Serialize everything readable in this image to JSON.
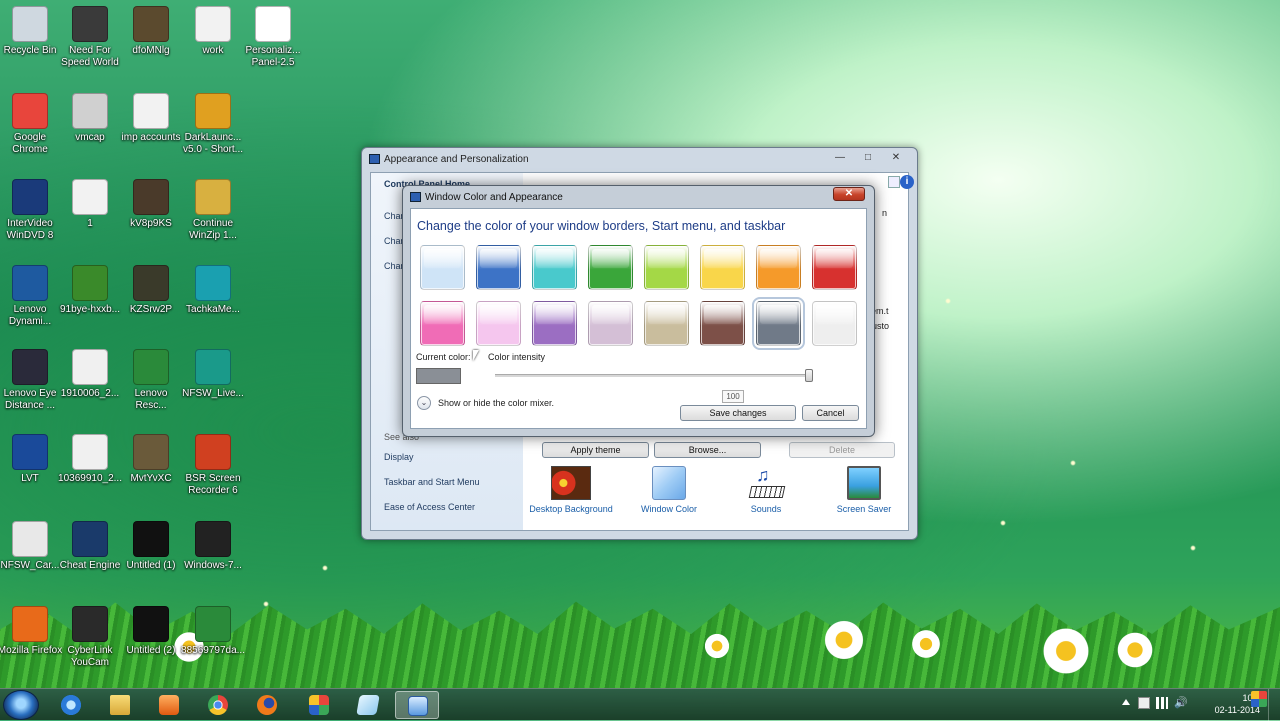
{
  "desktop": {
    "icons": [
      {
        "label": "Recycle Bin",
        "col": 0,
        "row": 0,
        "color": "#cfd8e0"
      },
      {
        "label": "Need For Speed World",
        "col": 1,
        "row": 0,
        "color": "#3a3a3a"
      },
      {
        "label": "dfoMNlg",
        "col": 2,
        "row": 0,
        "color": "#5b4a2e"
      },
      {
        "label": "work",
        "col": 3,
        "row": 0,
        "color": "#f2f2f2"
      },
      {
        "label": "Personaliz... Panel-2.5",
        "col": 4,
        "row": 0,
        "color": "#ffffff"
      },
      {
        "label": "Google Chrome",
        "col": 0,
        "row": 1,
        "color": "#e8453c"
      },
      {
        "label": "vmcap",
        "col": 1,
        "row": 1,
        "color": "#d0d0d0"
      },
      {
        "label": "imp accounts",
        "col": 2,
        "row": 1,
        "color": "#f2f2f2"
      },
      {
        "label": "DarkLaunc... v5.0 - Short...",
        "col": 3,
        "row": 1,
        "color": "#e0a020"
      },
      {
        "label": "InterVideo WinDVD 8",
        "col": 0,
        "row": 2,
        "color": "#1a3a7a"
      },
      {
        "label": "1",
        "col": 1,
        "row": 2,
        "color": "#f2f2f2"
      },
      {
        "label": "kV8p9KS",
        "col": 2,
        "row": 2,
        "color": "#4a3a2a"
      },
      {
        "label": "Continue WinZip 1...",
        "col": 3,
        "row": 2,
        "color": "#d8b040"
      },
      {
        "label": "Lenovo Dynami...",
        "col": 0,
        "row": 3,
        "color": "#1e5aa0"
      },
      {
        "label": "91bye-hxxb...",
        "col": 1,
        "row": 3,
        "color": "#3a8a2a"
      },
      {
        "label": "KZSrw2P",
        "col": 2,
        "row": 3,
        "color": "#3a3a2a"
      },
      {
        "label": "TachkaMe...",
        "col": 3,
        "row": 3,
        "color": "#1aa0b0"
      },
      {
        "label": "Lenovo Eye Distance ...",
        "col": 0,
        "row": 4,
        "color": "#2a2a3a"
      },
      {
        "label": "1910006_2...",
        "col": 1,
        "row": 4,
        "color": "#f0f0f0"
      },
      {
        "label": "Lenovo Resc...",
        "col": 2,
        "row": 4,
        "color": "#2a8a3a"
      },
      {
        "label": "NFSW_Live...",
        "col": 3,
        "row": 4,
        "color": "#1a9a8a"
      },
      {
        "label": "LVT",
        "col": 0,
        "row": 5,
        "color": "#1a4a9a"
      },
      {
        "label": "10369910_2...",
        "col": 1,
        "row": 5,
        "color": "#f0f0f0"
      },
      {
        "label": "MvtYvXC",
        "col": 2,
        "row": 5,
        "color": "#6a5a3a"
      },
      {
        "label": "BSR Screen Recorder 6",
        "col": 3,
        "row": 5,
        "color": "#d04020"
      },
      {
        "label": "NFSW_Car...",
        "col": 0,
        "row": 6,
        "color": "#e8e8e8"
      },
      {
        "label": "Cheat Engine",
        "col": 1,
        "row": 6,
        "color": "#1a3a6a"
      },
      {
        "label": "Untitled (1)",
        "col": 2,
        "row": 6,
        "color": "#111111"
      },
      {
        "label": "Windows-7...",
        "col": 3,
        "row": 6,
        "color": "#222222"
      },
      {
        "label": "Mozilla Firefox",
        "col": 0,
        "row": 7,
        "color": "#e86a1a"
      },
      {
        "label": "CyberLink YouCam",
        "col": 1,
        "row": 7,
        "color": "#2a2a2a"
      },
      {
        "label": "Untitled (2)",
        "col": 2,
        "row": 7,
        "color": "#111111"
      },
      {
        "label": "88569797da...",
        "col": 3,
        "row": 7,
        "color": "#2a8a3a"
      }
    ]
  },
  "main_window": {
    "title": "Appearance and Personalization",
    "left_links": {
      "home": "Control Panel Home",
      "change1": "Chan",
      "change2": "Chan",
      "change3": "Chan",
      "see_also": "See also",
      "display": "Display",
      "taskbar": "Taskbar and Start Menu",
      "ease": "Ease of Access Center"
    },
    "right_fragments": {
      "top": "n",
      "mid1": "em.t",
      "mid2": "usto"
    },
    "buttons": {
      "apply": "Apply theme",
      "browse": "Browse...",
      "delete": "Delete"
    },
    "tiles": [
      {
        "label": "Desktop Background"
      },
      {
        "label": "Window Color"
      },
      {
        "label": "Sounds"
      },
      {
        "label": "Screen Saver"
      }
    ]
  },
  "dialog": {
    "title": "Window Color and Appearance",
    "heading": "Change the color of your window borders, Start menu, and taskbar",
    "swatches": [
      "#cfe4f7",
      "#3d73c6",
      "#49c9cc",
      "#3aa63a",
      "#a4d846",
      "#f9d64a",
      "#f59a2a",
      "#d7312f",
      "#f06cb6",
      "#f5c6ee",
      "#9b6ec2",
      "#d4bfd6",
      "#c9bd9d",
      "#7d5048",
      "#707a88",
      "#eeeeee"
    ],
    "selected_index": 14,
    "current_color_label": "Current color:",
    "intensity_label": "Color intensity",
    "intensity_value": "100",
    "mixer_label": "Show or hide the color mixer.",
    "save_label": "Save changes",
    "cancel_label": "Cancel"
  },
  "taskbar": {
    "clock_time": "10:5",
    "clock_date": "02-11-2014"
  }
}
